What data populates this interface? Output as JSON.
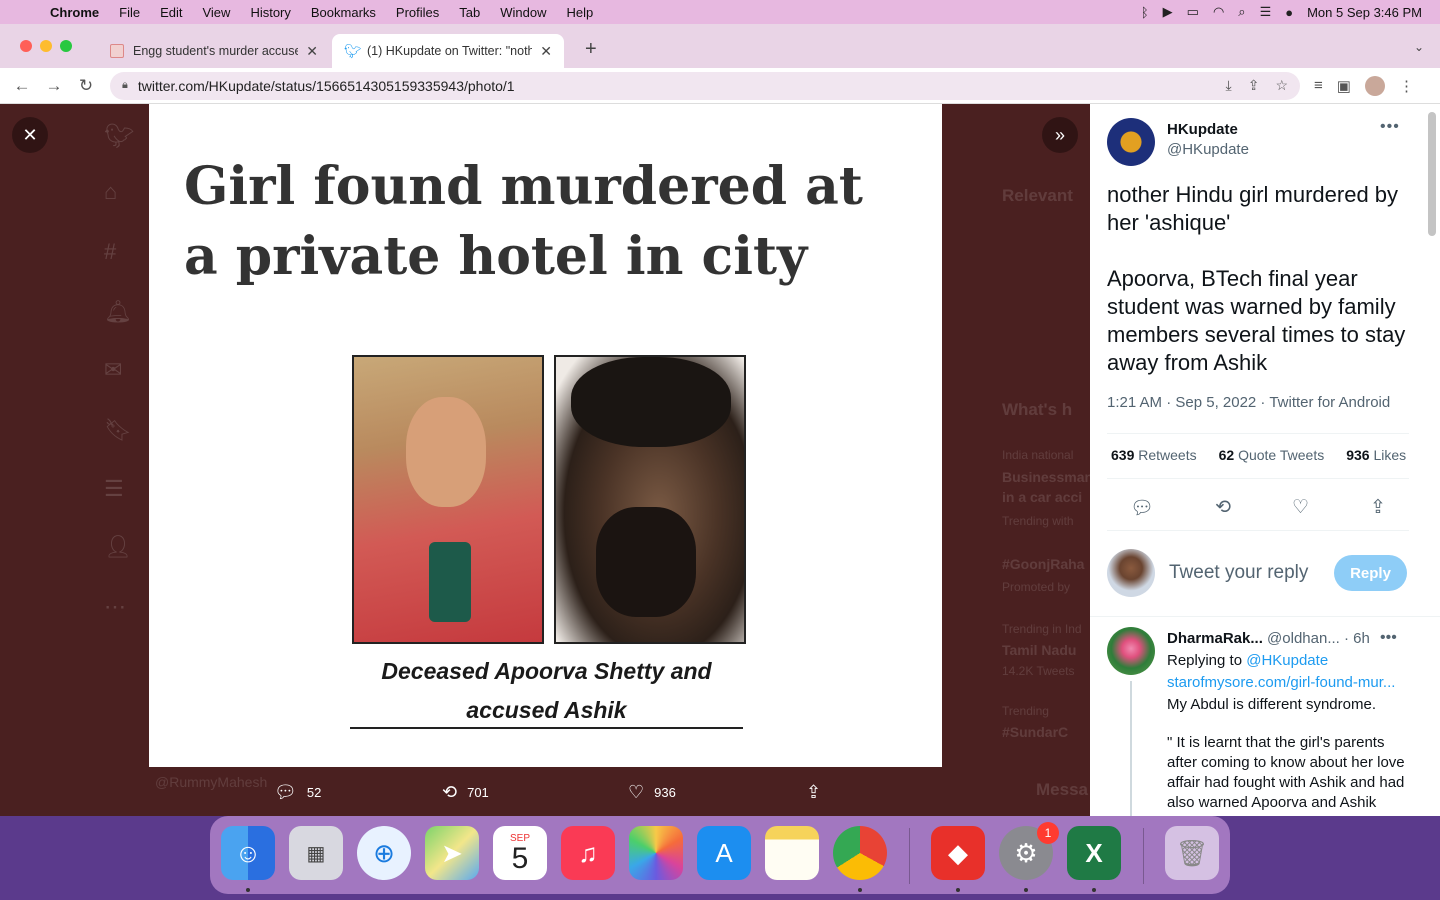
{
  "menubar": {
    "app": "Chrome",
    "items": [
      "File",
      "Edit",
      "View",
      "History",
      "Bookmarks",
      "Profiles",
      "Tab",
      "Window",
      "Help"
    ],
    "datetime": "Mon 5 Sep  3:46 PM"
  },
  "tabs": [
    {
      "title": "Engg student's murder accuse",
      "active": false
    },
    {
      "title": "(1) HKupdate on Twitter: \"noth",
      "active": true
    }
  ],
  "address": {
    "url": "twitter.com/HKupdate/status/1566514305159335943/photo/1"
  },
  "photo": {
    "headline": "Girl found murdered at a private hotel in city",
    "caption": "Deceased Apoorva Shetty and accused Ashik"
  },
  "media_actions": {
    "replies": "52",
    "retweets": "701",
    "likes": "936"
  },
  "background_ghost": {
    "relevant": "Relevant",
    "whats": "What's h",
    "trend1_meta": "India national",
    "trend1_title": "Businessman",
    "trend1_sub": "in a car acci",
    "trend1_foot": "Trending with",
    "trend2": "#GoonjRaha",
    "trend2_meta": "Promoted by",
    "trend3_meta": "Trending in Ind",
    "trend3": "Tamil Nadu",
    "trend3_count": "14.2K Tweets",
    "trend4_meta": "Trending",
    "trend4": "#SundarC",
    "handle": "@RummyMahesh",
    "messages": "Messa"
  },
  "tweet": {
    "author_name": "HKupdate",
    "author_handle": "@HKupdate",
    "text": "nother Hindu girl murdered by her 'ashique'\n\nApoorva, BTech final year student was warned by family members several times to stay away from Ashik",
    "meta": "1:21 AM · Sep 5, 2022 · Twitter for Android",
    "retweets": "639",
    "retweets_label": "Retweets",
    "quotes": "62",
    "quotes_label": "Quote Tweets",
    "likes": "936",
    "likes_label": "Likes"
  },
  "reply_box": {
    "placeholder": "Tweet your reply",
    "button": "Reply"
  },
  "reply": {
    "name": "DharmaRak...",
    "handle": "@oldhan...",
    "time": "· 6h",
    "replying_prefix": "Replying to",
    "replying_to": "@HKupdate",
    "link": "starofmysore.com/girl-found-mur...",
    "line1": "My Abdul is different syndrome.",
    "body": "\" It is learnt that the girl's parents after coming to know about her love affair had fought with Ashik and had also warned Apoorva and Ashik"
  },
  "dock": {
    "calendar_month": "SEP",
    "calendar_day": "5",
    "settings_badge": "1"
  }
}
